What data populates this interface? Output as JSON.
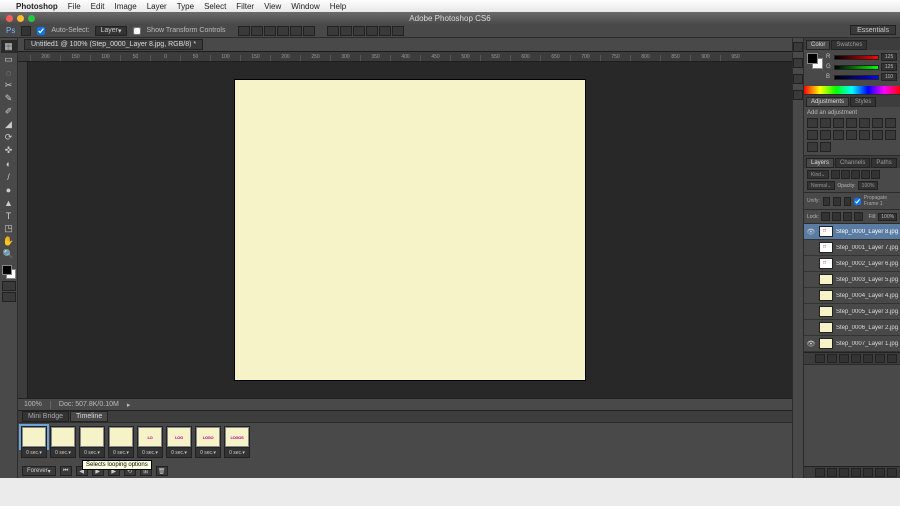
{
  "menubar": {
    "app": "Photoshop",
    "items": [
      "File",
      "Edit",
      "Image",
      "Layer",
      "Type",
      "Select",
      "Filter",
      "View",
      "Window",
      "Help"
    ]
  },
  "window_title": "Adobe Photoshop CS6",
  "workspace_chip": "Essentials",
  "options_bar": {
    "auto_select": "Auto-Select:",
    "auto_select_mode": "Layer",
    "show_transform": "Show Transform Controls"
  },
  "doc_tab": "Untitled1 @ 100% (Step_0000_Layer 8.jpg, RGB/8) *",
  "ruler_marks": [
    "200",
    "150",
    "100",
    "50",
    "0",
    "50",
    "100",
    "150",
    "200",
    "250",
    "300",
    "350",
    "400",
    "450",
    "500",
    "550",
    "600",
    "650",
    "700",
    "750",
    "800",
    "850",
    "900",
    "950"
  ],
  "status": {
    "zoom": "100%",
    "doc": "Doc: 507.8K/0.10M"
  },
  "timeline": {
    "tabs": [
      "Mini Bridge",
      "Timeline"
    ],
    "frames": [
      {
        "label": "",
        "dur": "0 sec.▾"
      },
      {
        "label": "",
        "dur": "0 sec.▾"
      },
      {
        "label": "",
        "dur": "0 sec.▾"
      },
      {
        "label": "",
        "dur": "0 sec.▾"
      },
      {
        "label": "LO",
        "dur": "0 sec.▾"
      },
      {
        "label": "LOG",
        "dur": "0 sec.▾"
      },
      {
        "label": "LOGO",
        "dur": "0 sec.▾"
      },
      {
        "label": "LOGOS",
        "dur": "0 sec.▾"
      }
    ],
    "loop": "Forever",
    "tooltip": "Selects looping options"
  },
  "panels": {
    "color": {
      "tabs": [
        "Color",
        "Swatches"
      ],
      "r": "125",
      "g": "125",
      "b": "110"
    },
    "adjustments": {
      "tabs": [
        "Adjustments",
        "Styles"
      ],
      "header": "Add an adjustment"
    },
    "layers": {
      "tabs": [
        "Layers",
        "Channels",
        "Paths"
      ],
      "kind": "Kind",
      "blend": "Normal",
      "opacity_label": "Opacity:",
      "opacity": "100%",
      "unify": "Unify:",
      "propagate": "Propagate Frame 1",
      "lock": "Lock:",
      "fill_label": "Fill:",
      "fill": "100%",
      "items": [
        {
          "name": "Step_0000_Layer 8.jpg",
          "vis": true,
          "sel": true,
          "logo": true
        },
        {
          "name": "Step_0001_Layer 7.jpg",
          "vis": false,
          "logo": true
        },
        {
          "name": "Step_0002_Layer 6.jpg",
          "vis": false,
          "logo": true
        },
        {
          "name": "Step_0003_Layer 5.jpg",
          "vis": false,
          "logo": false
        },
        {
          "name": "Step_0004_Layer 4.jpg",
          "vis": false,
          "logo": false
        },
        {
          "name": "Step_0005_Layer 3.jpg",
          "vis": false,
          "logo": false
        },
        {
          "name": "Step_0006_Layer 2.jpg",
          "vis": false,
          "logo": false
        },
        {
          "name": "Step_0007_Layer 1.jpg",
          "vis": true,
          "logo": false
        }
      ]
    }
  },
  "tools_glyphs": [
    "▦",
    "▭",
    "◌",
    "✂",
    "✎",
    "✐",
    "◢",
    "⟳",
    "✜",
    "◐",
    "/",
    "●",
    "▲",
    "T",
    "◳",
    "✋",
    "🔍"
  ]
}
